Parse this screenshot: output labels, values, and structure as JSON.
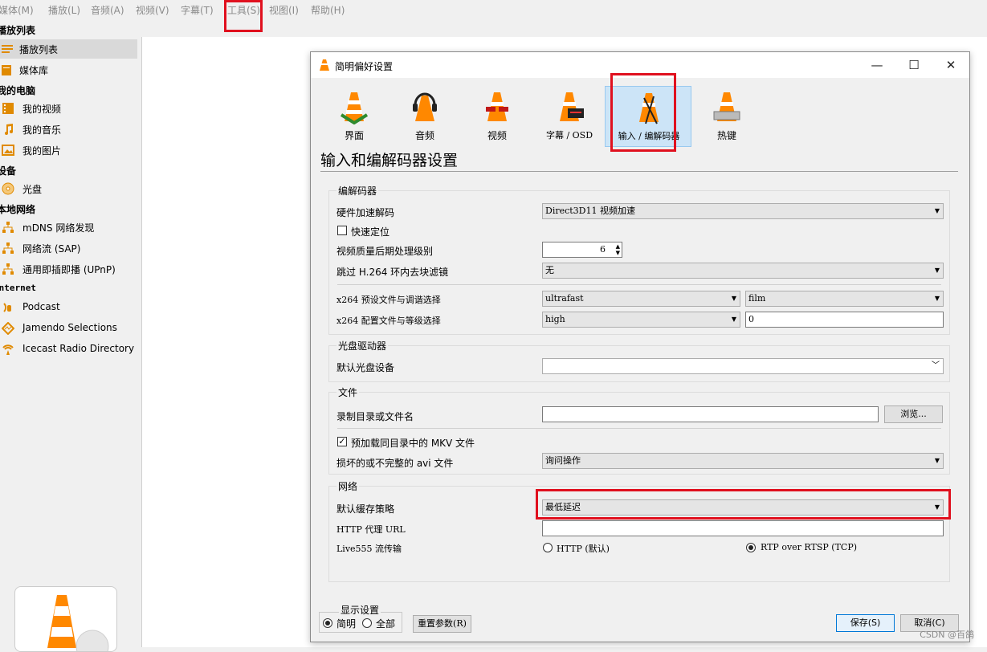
{
  "menubar": {
    "items": [
      "媒体(M)",
      "播放(L)",
      "音频(A)",
      "视频(V)",
      "字幕(T)",
      "工具(S)",
      "视图(I)",
      "帮助(H)"
    ]
  },
  "sidebar": {
    "playlist_header": "播放列表",
    "playlist_items": [
      "播放列表",
      "媒体库"
    ],
    "computer_header": "我的电脑",
    "computer_items": [
      "我的视频",
      "我的音乐",
      "我的图片"
    ],
    "devices_header": "设备",
    "devices_items": [
      "光盘"
    ],
    "lan_header": "本地网络",
    "lan_items": [
      "mDNS 网络发现",
      "网络流 (SAP)",
      "通用即插即播 (UPnP)"
    ],
    "internet_header": "Internet",
    "internet_items": [
      "Podcast",
      "Jamendo Selections",
      "Icecast Radio Directory"
    ]
  },
  "dialog": {
    "title": "简明偏好设置",
    "categories": [
      "界面",
      "音频",
      "视频",
      "字幕 / OSD",
      "输入 / 编解码器",
      "热键"
    ],
    "section_title": "输入和编解码器设置",
    "codecs": {
      "group": "编解码器",
      "hw_label": "硬件加速解码",
      "hw_value": "Direct3D11 视频加速",
      "fast_seek": "快速定位",
      "pp_label": "视频质量后期处理级别",
      "pp_value": "6",
      "h264_label": "跳过 H.264 环内去块滤镜",
      "h264_value": "无",
      "x264_preset_label": "x264 预设文件与调谐选择",
      "x264_preset_value": "ultrafast",
      "x264_tune_value": "film",
      "x264_profile_label": "x264 配置文件与等级选择",
      "x264_profile_value": "high",
      "x264_level_value": "0"
    },
    "disc": {
      "group": "光盘驱动器",
      "default_label": "默认光盘设备",
      "default_value": ""
    },
    "files": {
      "group": "文件",
      "record_label": "录制目录或文件名",
      "record_value": "",
      "browse": "浏览...",
      "mkv_label": "预加载同目录中的 MKV 文件",
      "avi_label": "损坏的或不完整的 avi 文件",
      "avi_value": "询问操作"
    },
    "network": {
      "group": "网络",
      "cache_label": "默认缓存策略",
      "cache_value": "最低延迟",
      "proxy_label": "HTTP 代理 URL",
      "proxy_value": "",
      "live555_label": "Live555 流传输",
      "http_option": "HTTP (默认)",
      "rtp_option": "RTP over RTSP (TCP)"
    },
    "display": {
      "group": "显示设置",
      "simple": "简明",
      "all": "全部"
    },
    "reset": "重置参数(R)",
    "save": "保存(S)",
    "cancel": "取消(C)"
  },
  "watermark": "CSDN @百鸽"
}
